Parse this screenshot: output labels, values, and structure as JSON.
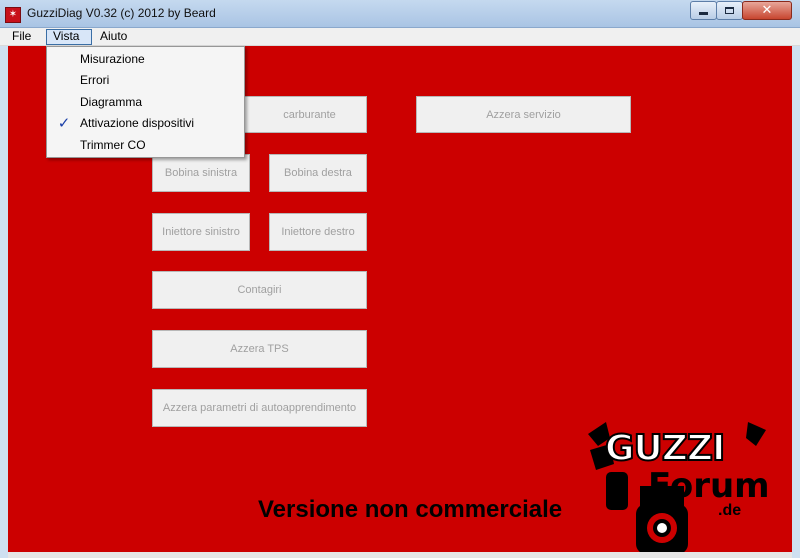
{
  "window": {
    "title": "GuzziDiag V0.32 (c) 2012 by Beard",
    "app_icon_glyph": "✶",
    "close_glyph": "✕"
  },
  "menubar": {
    "file": "File",
    "vista": "Vista",
    "aiuto": "Aiuto"
  },
  "vista_menu": {
    "items": [
      {
        "label": "Misurazione",
        "checked": false
      },
      {
        "label": "Errori",
        "checked": false
      },
      {
        "label": "Diagramma",
        "checked": false
      },
      {
        "label": "Attivazione dispositivi",
        "checked": true
      },
      {
        "label": "Trimmer CO",
        "checked": false
      }
    ],
    "check_glyph": "✓"
  },
  "buttons": {
    "carburante": "carburante",
    "azzera_servizio": "Azzera servizio",
    "bobina_sinistra": "Bobina sinistra",
    "bobina_destra": "Bobina destra",
    "iniettore_sinistro": "Iniettore sinistro",
    "iniettore_destro": "Iniettore destro",
    "contagiri": "Contagiri",
    "azzera_tps": "Azzera TPS",
    "azzera_parametri": "Azzera parametri di autoapprendimento"
  },
  "watermark": "Versione non commerciale",
  "logo": {
    "line1": "GUZZI",
    "line2": "Forum",
    "line3": ".de"
  },
  "colors": {
    "client_background": "#cc0000",
    "check_color": "#1a3fa8"
  }
}
